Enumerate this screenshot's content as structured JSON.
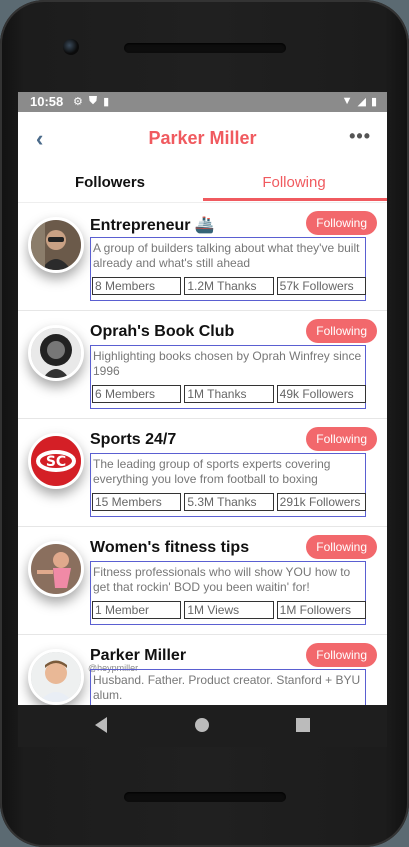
{
  "status": {
    "time": "10:58"
  },
  "header": {
    "title": "Parker Miller"
  },
  "tabs": {
    "followers": "Followers",
    "following": "Following"
  },
  "items": [
    {
      "name": "Entrepreneur 🚢",
      "button": "Following",
      "description": "A group of builders talking about what they've built already and what's still ahead",
      "stats": [
        "8 Members",
        "1.2M Thanks",
        "57k Followers"
      ]
    },
    {
      "name": "Oprah's Book Club",
      "button": "Following",
      "description": "Highlighting books chosen by Oprah Winfrey since 1996",
      "stats": [
        "6 Members",
        "1M Thanks",
        "49k Followers"
      ]
    },
    {
      "name": "Sports 24/7",
      "button": "Following",
      "description": "The leading group of sports experts covering everything you love from football to boxing",
      "stats": [
        "15 Members",
        "5.3M Thanks",
        "291k Followers"
      ]
    },
    {
      "name": "Women's fitness tips",
      "button": "Following",
      "description": "Fitness professionals who will show YOU how to get that rockin' BOD you been waitin' for!",
      "stats": [
        "1 Member",
        "1M Views",
        "1M Followers"
      ]
    },
    {
      "name": "Parker Miller",
      "handle": "@heypmiller",
      "button": "Following",
      "description": "Husband. Father. Product creator. Stanford + BYU alum.",
      "stats": []
    }
  ]
}
